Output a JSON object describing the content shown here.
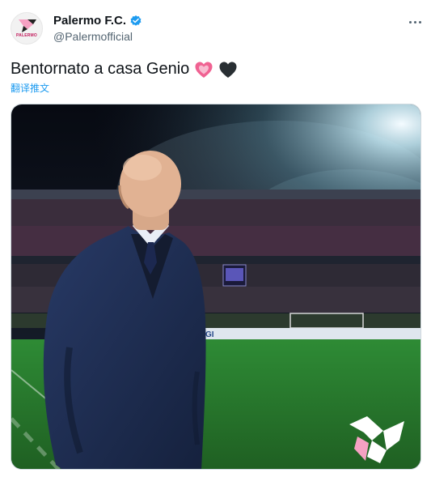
{
  "tweet": {
    "display_name": "Palermo F.C.",
    "handle": "@Palermofficial",
    "avatar_caption": "PALERMO",
    "text": "Bentornato a casa Genio",
    "translate_label": "翻译推文",
    "board_text": "GI"
  },
  "icons": {
    "verified": "verified-badge-icon",
    "more": "more-options-icon",
    "heart_pink": "sparkling-heart-emoji",
    "heart_black": "black-heart-emoji"
  },
  "colors": {
    "verified": "#1d9bf0",
    "link": "#1d9bf0",
    "handle": "#536471",
    "palermo_pink": "#f6a1c3",
    "pitch": "#2f8a2f"
  }
}
